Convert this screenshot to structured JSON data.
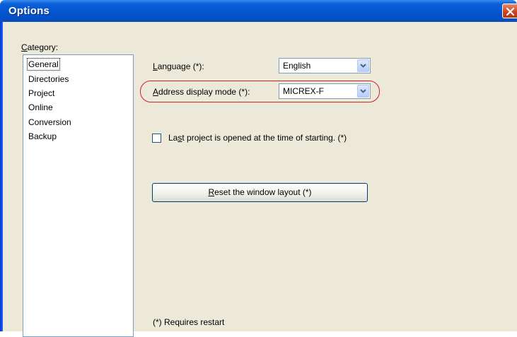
{
  "window": {
    "title": "Options"
  },
  "category": {
    "label_accel": "C",
    "label_rest": "ategory:",
    "items": [
      "General",
      "Directories",
      "Project",
      "Online",
      "Conversion",
      "Backup"
    ],
    "selected": "General"
  },
  "language": {
    "label_accel": "L",
    "label_rest": "anguage (*):",
    "value": "English"
  },
  "address_mode": {
    "label_accel": "A",
    "label_rest": "ddress display mode (*):",
    "value": "MICREX-F"
  },
  "last_project": {
    "label_pre": "La",
    "label_accel": "s",
    "label_rest": "t project is opened at the time of starting. (*)",
    "checked": false
  },
  "reset_button": {
    "label_accel": "R",
    "label_rest": "eset the window layout (*)"
  },
  "footnote": "(*) Requires restart",
  "colors": {
    "title_bar": "#0554d0",
    "highlight_ring": "#d0202a",
    "dialog_bg": "#ece9d8"
  }
}
